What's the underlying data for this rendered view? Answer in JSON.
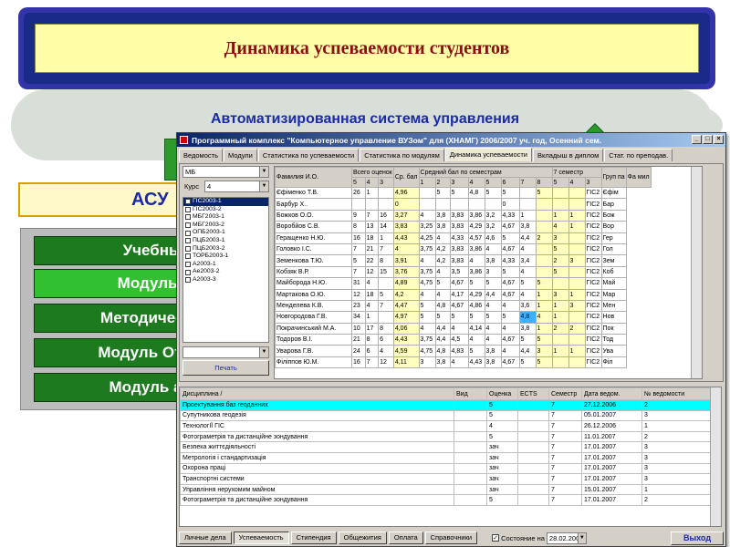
{
  "slide": {
    "title": "Динамика успеваемости студентов",
    "cloud_text": "Автоматизированная система управления",
    "asu_label": "АСУ",
    "modules": [
      "Учебный",
      "Модуль д",
      "Методическ",
      "Модуль Отд",
      "Модуль аб"
    ],
    "active_module_index": 1
  },
  "window": {
    "title": "Программный комплекс \"Компьютерное управление ВУЗом\" для        (ХНАМГ)    2006/2007 уч. год, Осенний сем.",
    "controls": [
      "_",
      "□",
      "×"
    ],
    "tabs": [
      "Ведомость",
      "Модули",
      "Статистика по успеваемости",
      "Статистика по модулям",
      "Динамика успеваемости",
      "Вкладыш в диплом",
      "Стат. по преподав."
    ],
    "active_tab": "Динамика успеваемости"
  },
  "filters": {
    "faculty": "МБ",
    "course_label": "Курс",
    "course": "4",
    "groups": [
      {
        "name": "ГІС2003-1",
        "selected": true
      },
      {
        "name": "ГІС2003-2",
        "selected": false
      },
      {
        "name": "МБГ2003-1",
        "selected": false
      },
      {
        "name": "МБГ2003-2",
        "selected": false
      },
      {
        "name": "ОПБ2003-1",
        "selected": false
      },
      {
        "name": "ПЦБ2003-1",
        "selected": false
      },
      {
        "name": "ПЦБ2003-2",
        "selected": false
      },
      {
        "name": "ТОРБ2003-1",
        "selected": false
      },
      {
        "name": "А2003-1",
        "selected": false
      },
      {
        "name": "Ае2003-2",
        "selected": false
      },
      {
        "name": "А2003-3",
        "selected": false
      }
    ],
    "bottom_combo": "",
    "print_button": "Печать"
  },
  "grades": {
    "headers": {
      "name": "Фамилия И.О.",
      "total": "Всего оценок",
      "avg": "Ср. бал",
      "avg_by_sem": "Средний бал по семестрам",
      "sem7": "7 семестр",
      "group": "Груп па",
      "fam": "Фа мил"
    },
    "sub_total": [
      "5",
      "4",
      "3"
    ],
    "sub_sem": [
      "1",
      "2",
      "3",
      "4",
      "5",
      "6",
      "7",
      "8"
    ],
    "sub_sem7": [
      "5",
      "4",
      "3"
    ],
    "rows": [
      [
        "Єфіменко Т.В.",
        "26",
        "1",
        "",
        "4,96",
        "",
        "5",
        "5",
        "4,8",
        "5",
        "5",
        "",
        "5",
        "",
        "",
        "ГІС2",
        "Єфім"
      ],
      [
        "Барбур  Х..",
        "",
        "",
        "",
        "0",
        "",
        "",
        "",
        "",
        "",
        "0",
        "",
        "",
        "",
        "",
        "ГІС2",
        "Бар"
      ],
      [
        "Божков О.О.",
        "9",
        "7",
        "16",
        "3,27",
        "4",
        "3,8",
        "3,83",
        "3,86",
        "3,2",
        "4,33",
        "1",
        "",
        "1",
        "1",
        "ГІС2",
        "Бож"
      ],
      [
        "Воробйов С.В.",
        "8",
        "13",
        "14",
        "3,83",
        "3,25",
        "3,8",
        "3,83",
        "4,29",
        "3,2",
        "4,67",
        "3,8",
        "",
        "4",
        "1",
        "ГІС2",
        "Вор"
      ],
      [
        "Геращенко Н.Ю.",
        "16",
        "18",
        "1",
        "4,43",
        "4,25",
        "4",
        "4,33",
        "4,57",
        "4,6",
        "5",
        "4,4",
        "2",
        "3",
        "",
        "ГІС2",
        "Гер"
      ],
      [
        "Головко І.С.",
        "7",
        "21",
        "7",
        "4",
        "3,75",
        "4,2",
        "3,83",
        "3,86",
        "4",
        "4,67",
        "4",
        "",
        "5",
        "",
        "ГІС2",
        "Гол"
      ],
      [
        "Земенкова Т.Ю.",
        "5",
        "22",
        "8",
        "3,91",
        "4",
        "4,2",
        "3,83",
        "4",
        "3,8",
        "4,33",
        "3,4",
        "",
        "2",
        "3",
        "ГІС2",
        "Зем"
      ],
      [
        "Кобзяк В.Р.",
        "7",
        "12",
        "15",
        "3,76",
        "3,75",
        "4",
        "3,5",
        "3,86",
        "3",
        "5",
        "4",
        "",
        "5",
        "",
        "ГІС2",
        "Коб"
      ],
      [
        "Майборода Н.Ю.",
        "31",
        "4",
        "",
        "4,89",
        "4,75",
        "5",
        "4,67",
        "5",
        "5",
        "4,67",
        "5",
        "5",
        "",
        "",
        "ГІС2",
        "Май"
      ],
      [
        "Мартакова О.Ю.",
        "12",
        "18",
        "5",
        "4,2",
        "4",
        "4",
        "4,17",
        "4,29",
        "4,4",
        "4,67",
        "4",
        "1",
        "3",
        "1",
        "ГІС2",
        "Мар"
      ],
      [
        "Менделева К.В.",
        "23",
        "4",
        "7",
        "4,47",
        "5",
        "4,8",
        "4,67",
        "4,86",
        "4",
        "4",
        "3,6",
        "1",
        "1",
        "3",
        "ГІС2",
        "Мен"
      ],
      [
        "Новгородова Г.В.",
        "34",
        "1",
        "",
        "4,97",
        "5",
        "5",
        "5",
        "5",
        "5",
        "5",
        "4,8",
        "4",
        "1",
        "",
        "ГІС2",
        "Нов"
      ],
      [
        "Покрачинський М.А.",
        "10",
        "17",
        "8",
        "4,06",
        "4",
        "4,4",
        "4",
        "4,14",
        "4",
        "4",
        "3,8",
        "1",
        "2",
        "2",
        "ГІС2",
        "Пок"
      ],
      [
        "Тодоров В.І.",
        "21",
        "8",
        "6",
        "4,43",
        "3,75",
        "4,4",
        "4,5",
        "4",
        "4",
        "4,67",
        "5",
        "5",
        "",
        "",
        "ГІС2",
        "Тод"
      ],
      [
        "Уварова Г.В.",
        "24",
        "6",
        "4",
        "4,59",
        "4,75",
        "4,8",
        "4,83",
        "5",
        "3,8",
        "4",
        "4,4",
        "3",
        "1",
        "1",
        "ГІС2",
        "Ува"
      ],
      [
        "Філіппов Ю.М.",
        "16",
        "7",
        "12",
        "4,11",
        "3",
        "3,8",
        "4",
        "4,43",
        "3,8",
        "4,67",
        "5",
        "5",
        "",
        "",
        "ГІС2",
        "Філ"
      ]
    ],
    "current_cell": {
      "row": 11,
      "col": 11
    }
  },
  "disciplines": {
    "headers": [
      "Дисциплина /",
      "Вид",
      "Оценка",
      "ECTS",
      "Семестр",
      "Дата ведом.",
      "№ ведомости"
    ],
    "rows": [
      [
        "Проектування баз геоданних",
        "",
        "5",
        "",
        "7",
        "27.12.2006",
        "2"
      ],
      [
        "Супутникова геодезія",
        "",
        "5",
        "",
        "7",
        "05.01.2007",
        "3"
      ],
      [
        "ТехнологІЇ ГІС",
        "",
        "4",
        "",
        "7",
        "26.12.2006",
        "1"
      ],
      [
        "Фотограметрія та дистанційне зондування",
        "",
        "5",
        "",
        "7",
        "11.01.2007",
        "2"
      ],
      [
        "Безпека життєдіяльності",
        "",
        "зач",
        "",
        "7",
        "17.01.2007",
        "3"
      ],
      [
        "Метрологія і стандартизація",
        "",
        "зач",
        "",
        "7",
        "17.01.2007",
        "3"
      ],
      [
        "Охорона праці",
        "",
        "зач",
        "",
        "7",
        "17.01.2007",
        "3"
      ],
      [
        "Транспортні системи",
        "",
        "зач",
        "",
        "7",
        "17.01.2007",
        "3"
      ],
      [
        "Управління нерухомим майном",
        "",
        "зач",
        "",
        "7",
        "15.01.2007",
        "1"
      ],
      [
        "Фотограметрія та дистанційне зондування",
        "",
        "5",
        "",
        "7",
        "17.01.2007",
        "2"
      ]
    ],
    "selected_row": 0
  },
  "bottom_bar": {
    "tabs": [
      "Личные дела",
      "Успеваемость",
      "Стипендия",
      "Общежития",
      "Оплата",
      "Справочники"
    ],
    "active_tab": "Успеваемость",
    "checkbox_label": "Состояние на",
    "checkbox_checked": true,
    "date": "28.02.2007",
    "exit": "Выход"
  },
  "colors": {
    "title_text": "#8a1010",
    "banner_bg": "#ffffa8",
    "module_button": "#1e7a1e",
    "module_active": "#30c030",
    "selected_row": "#00ffff",
    "current_cell": "#3ab0ff"
  }
}
